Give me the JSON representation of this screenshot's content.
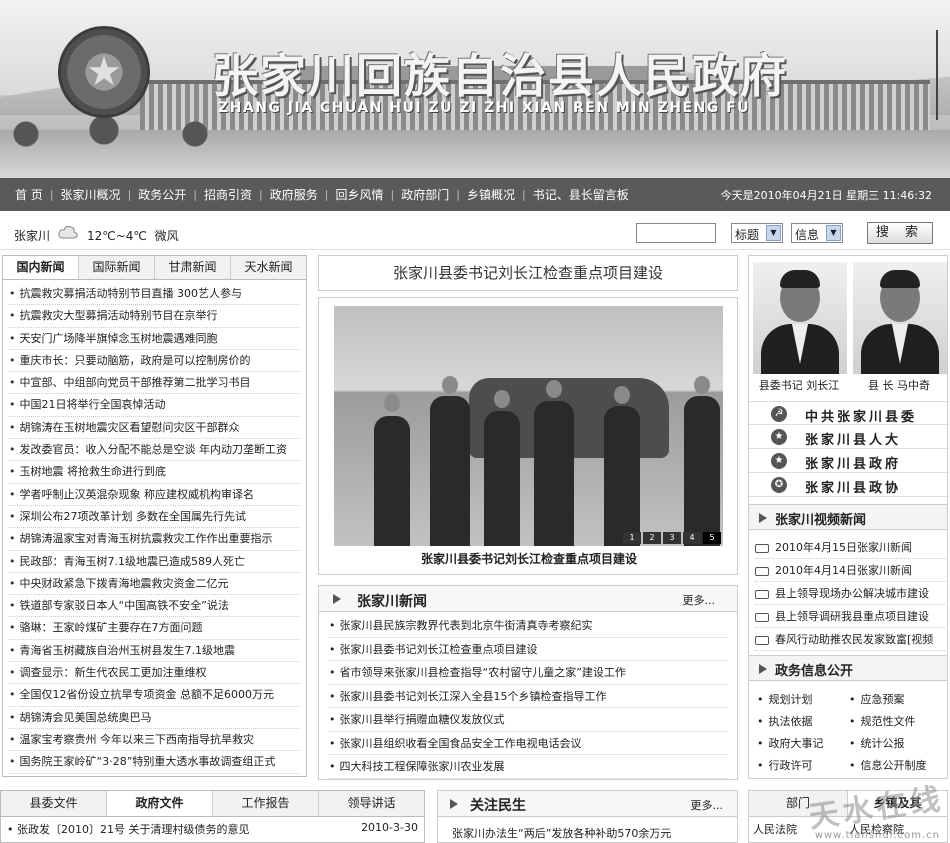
{
  "header": {
    "title": "张家川回族自治县人民政府",
    "subtitle": "ZHANG JIA CHUAN HUI ZU ZI ZHI XIAN REN MIN ZHENG FU"
  },
  "nav": {
    "items": [
      "首 页",
      "张家川概况",
      "政务公开",
      "招商引资",
      "政府服务",
      "回乡风情",
      "政府部门",
      "乡镇概况",
      "书记、县长留言板"
    ],
    "datetime": "今天是2010年04月21日 星期三 11:46:32"
  },
  "weather": {
    "city": "张家川",
    "temp": "12℃~4℃",
    "wind": "微风",
    "icon": "cloud-icon"
  },
  "search": {
    "field_select": "标题",
    "type_select": "信息",
    "button": "搜 索"
  },
  "left_tabs": [
    "国内新闻",
    "国际新闻",
    "甘肃新闻",
    "天水新闻"
  ],
  "left_news": [
    "抗震救灾募捐活动特别节目直播 300艺人参与",
    "抗震救灾大型募捐活动特别节目在京举行",
    "天安门广场降半旗悼念玉树地震遇难同胞",
    "重庆市长：只要动脑筋，政府是可以控制房价的",
    "中宣部、中组部向党员干部推荐第二批学习书目",
    "中国21日将举行全国哀悼活动",
    "胡锦涛在玉树地震灾区看望慰问灾区干部群众",
    "发改委官员：收入分配不能总是空谈 年内动刀垄断工资",
    "玉树地震 将抢救生命进行到底",
    "学者呼制止汉英混杂现象 称应建权威机构审译名",
    "深圳公布27项改革计划 多数在全国属先行先试",
    "胡锦涛温家宝对青海玉树抗震救灾工作作出重要指示",
    "民政部：青海玉树7.1级地震已造成589人死亡",
    "中央财政紧急下拨青海地震救灾资金二亿元",
    "铁道部专家驳日本人“中国高铁不安全”说法",
    "骆琳：王家岭煤矿主要存在7方面问题",
    "青海省玉树藏族自治州玉树县发生7.1级地震",
    "调查显示：新生代农民工更加注重维权",
    "全国仅12省份设立抗旱专项资金 总额不足6000万元",
    "胡锦涛会见美国总统奥巴马",
    "温家宝考察贵州 今年以来三下西南指导抗旱救灾",
    "国务院王家岭矿“3·28”特别重大透水事故调查组正式"
  ],
  "headline": "张家川县委书记刘长江检查重点项目建设",
  "photo": {
    "caption": "张家川县委书记刘长江检查重点项目建设",
    "pager": [
      "1",
      "2",
      "3",
      "4",
      "5"
    ],
    "active_page": 5
  },
  "local_news": {
    "title": "张家川新闻",
    "more": "更多...",
    "items": [
      "张家川县民族宗教界代表到北京牛街清真寺考察纪实",
      "张家川县委书记刘长江检查重点项目建设",
      "省市领导来张家川县检查指导“农村留守儿童之家”建设工作",
      "张家川县委书记刘长江深入全县15个乡镇检查指导工作",
      "张家川县举行捐赠血糖仪发放仪式",
      "张家川县组织收看全国食品安全工作电视电话会议",
      "四大科技工程保障张家川农业发展"
    ]
  },
  "leaders": [
    {
      "label": "县委书记 刘长江"
    },
    {
      "label": "县 长 马中奇"
    }
  ],
  "orgs": [
    {
      "label": "中共张家川县委",
      "icon": "party-emblem-icon"
    },
    {
      "label": "张家川县人大",
      "icon": "national-emblem-icon"
    },
    {
      "label": "张家川县政府",
      "icon": "national-emblem-icon"
    },
    {
      "label": "张家川县政协",
      "icon": "cppcc-emblem-icon"
    }
  ],
  "video_news": {
    "title": "张家川视频新闻",
    "items": [
      "2010年4月15日张家川新闻",
      "2010年4月14日张家川新闻",
      "县上领导现场办公解决城市建设",
      "县上领导调研我县重点项目建设",
      "春风行动助推农民发家致富[视频"
    ]
  },
  "gov_info": {
    "title": "政务信息公开",
    "items": [
      "规划计划",
      "应急预案",
      "执法依据",
      "规范性文件",
      "政府大事记",
      "统计公报",
      "行政许可",
      "信息公开制度"
    ]
  },
  "bottom_tabs": [
    "县委文件",
    "政府文件",
    "工作报告",
    "领导讲话"
  ],
  "doc": {
    "title": "张政发〔2010〕21号 关于清理村级债务的意见",
    "date": "2010-3-30"
  },
  "minsheng": {
    "title": "关注民生",
    "more": "更多...",
    "first_item": "张家川办法生“两后”发放各种补助570余万元"
  },
  "dept": {
    "tabs": [
      "部门",
      "乡镇及其"
    ],
    "row": [
      "人民法院",
      "人民检察院"
    ]
  },
  "watermark": {
    "text": "天水在线",
    "url": "www.tianshui.com.cn"
  }
}
